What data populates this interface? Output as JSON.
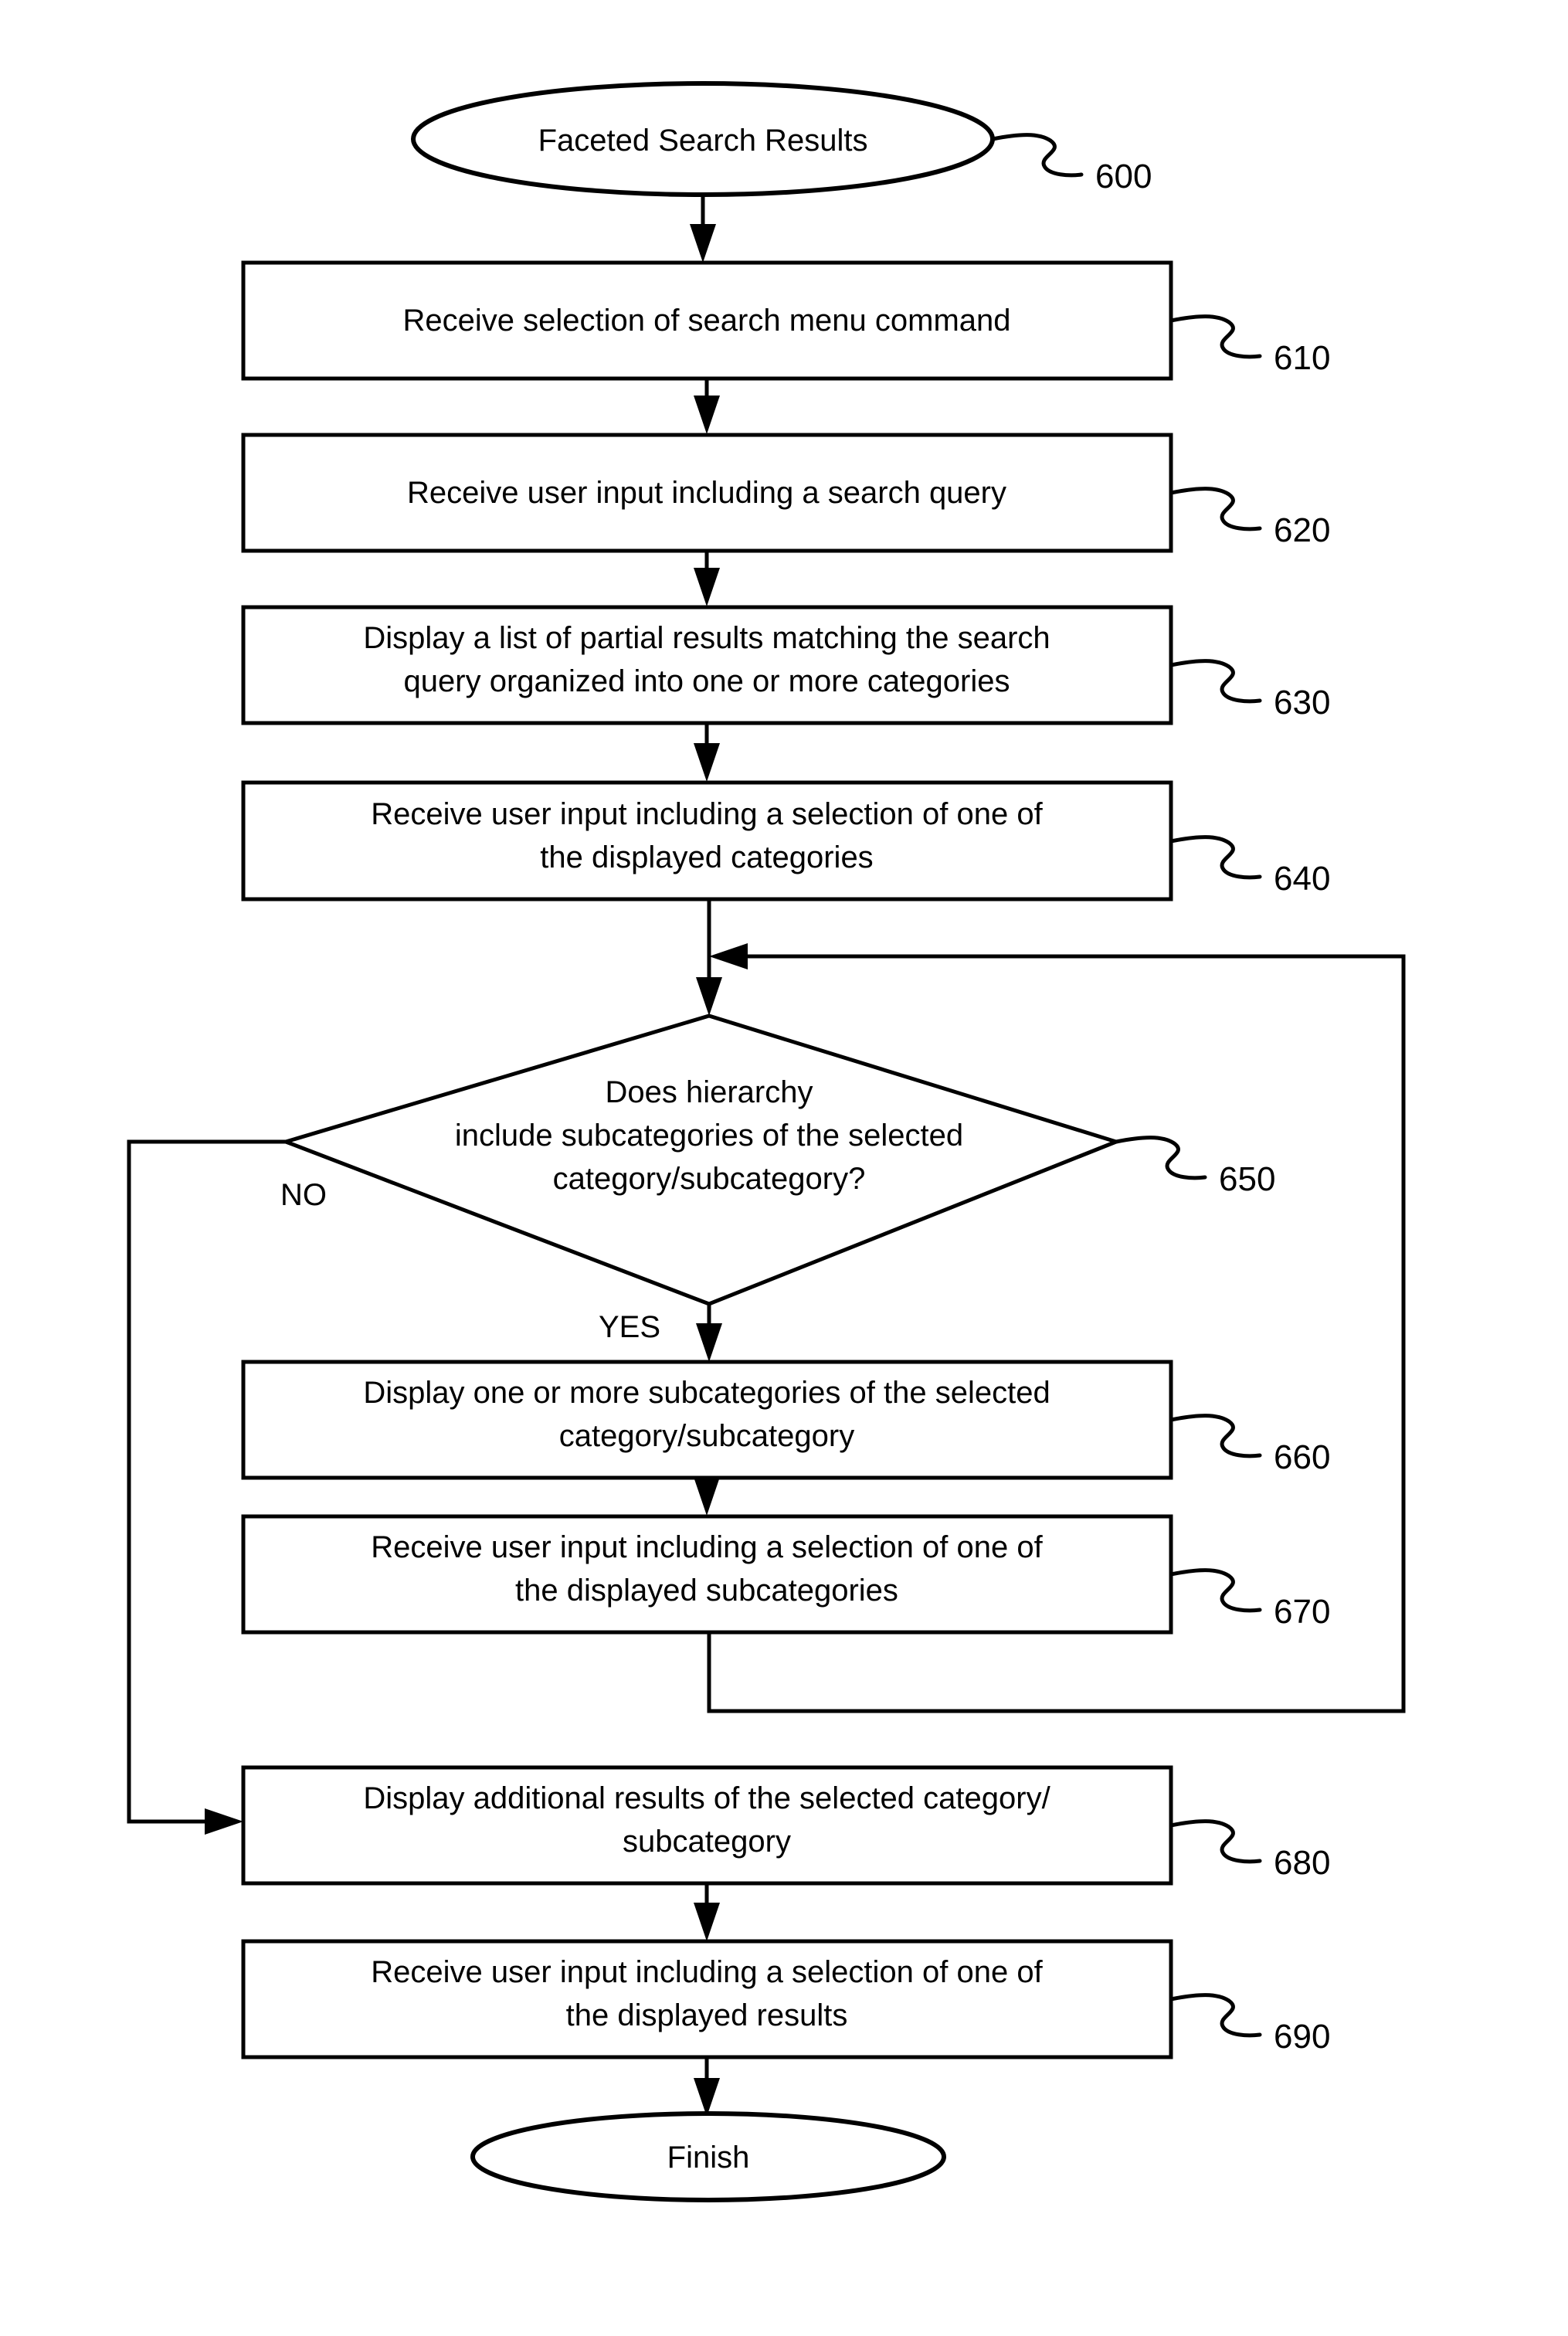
{
  "figure": {
    "title": "Faceted Search Results",
    "type": "flowchart"
  },
  "nodes": {
    "start": {
      "ref": "600",
      "label": "Faceted Search Results",
      "shape": "oval"
    },
    "step610": {
      "ref": "610",
      "line1": "Receive selection of search menu command",
      "line2": "",
      "shape": "process"
    },
    "step620": {
      "ref": "620",
      "line1": "Receive user input including a search query",
      "line2": "",
      "shape": "process"
    },
    "step630": {
      "ref": "630",
      "line1": "Display a list of partial results matching the search",
      "line2": "query organized into one or more categories",
      "shape": "process"
    },
    "step640": {
      "ref": "640",
      "line1": "Receive user input including a selection of one of",
      "line2": "the displayed categories",
      "shape": "process"
    },
    "decision650": {
      "ref": "650",
      "line1": "Does hierarchy",
      "line2": "include subcategories of the selected",
      "line3": "category/subcategory?",
      "shape": "diamond"
    },
    "step660": {
      "ref": "660",
      "line1": "Display one or more subcategories of the selected",
      "line2": "category/subcategory",
      "shape": "process"
    },
    "step670": {
      "ref": "670",
      "line1": "Receive user input including a selection of one of",
      "line2": "the displayed subcategories",
      "shape": "process"
    },
    "step680": {
      "ref": "680",
      "line1": "Display additional results of the selected category/",
      "line2": "subcategory",
      "shape": "process"
    },
    "step690": {
      "ref": "690",
      "line1": "Receive user input including a selection of one of",
      "line2": "the displayed results",
      "shape": "process"
    },
    "finish": {
      "label": "Finish",
      "shape": "oval"
    }
  },
  "branch_labels": {
    "no": "NO",
    "yes": "YES"
  },
  "colors": {
    "stroke": "#000000",
    "fill": "#ffffff",
    "background": "#ffffff"
  },
  "chart_data": {
    "type": "flowchart",
    "title": "Faceted Search Results",
    "nodes": [
      {
        "id": "600",
        "type": "terminal",
        "text": "Faceted Search Results"
      },
      {
        "id": "610",
        "type": "process",
        "text": "Receive selection of search menu command"
      },
      {
        "id": "620",
        "type": "process",
        "text": "Receive user input including a search query"
      },
      {
        "id": "630",
        "type": "process",
        "text": "Display a list of partial results matching the search query organized into one or more categories"
      },
      {
        "id": "640",
        "type": "process",
        "text": "Receive user input including a selection of one of the displayed categories"
      },
      {
        "id": "650",
        "type": "decision",
        "text": "Does hierarchy include subcategories of the selected category/subcategory?"
      },
      {
        "id": "660",
        "type": "process",
        "text": "Display one or more subcategories of the selected category/subcategory"
      },
      {
        "id": "670",
        "type": "process",
        "text": "Receive user input including a selection of one of the displayed subcategories"
      },
      {
        "id": "680",
        "type": "process",
        "text": "Display additional results of the selected category/subcategory"
      },
      {
        "id": "690",
        "type": "process",
        "text": "Receive user input including a selection of one of the displayed results"
      },
      {
        "id": "finish",
        "type": "terminal",
        "text": "Finish"
      }
    ],
    "edges": [
      {
        "from": "600",
        "to": "610",
        "label": ""
      },
      {
        "from": "610",
        "to": "620",
        "label": ""
      },
      {
        "from": "620",
        "to": "630",
        "label": ""
      },
      {
        "from": "630",
        "to": "640",
        "label": ""
      },
      {
        "from": "640",
        "to": "650",
        "label": ""
      },
      {
        "from": "650",
        "to": "660",
        "label": "YES"
      },
      {
        "from": "650",
        "to": "680",
        "label": "NO"
      },
      {
        "from": "660",
        "to": "670",
        "label": ""
      },
      {
        "from": "670",
        "to": "650",
        "label": ""
      },
      {
        "from": "680",
        "to": "690",
        "label": ""
      },
      {
        "from": "690",
        "to": "finish",
        "label": ""
      }
    ]
  }
}
